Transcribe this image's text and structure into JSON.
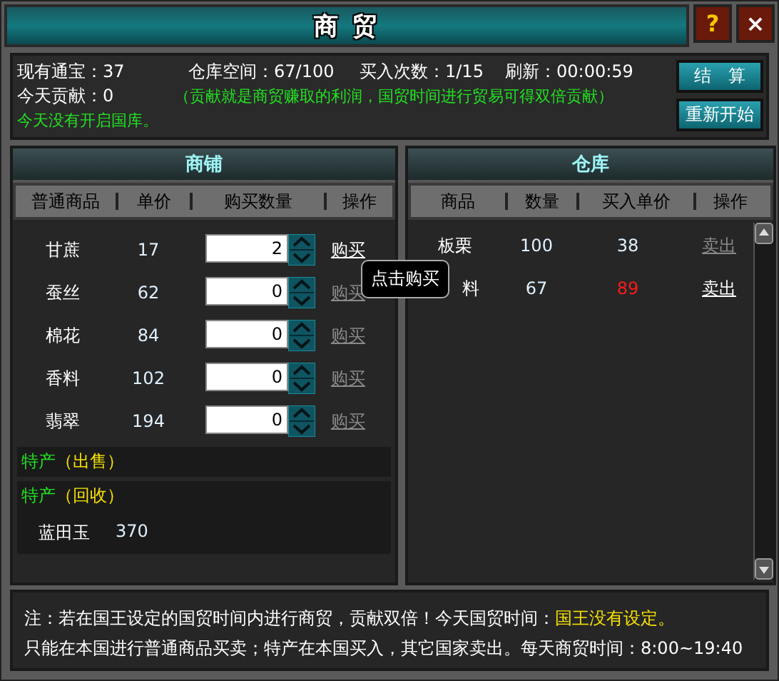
{
  "window": {
    "title": "商 贸",
    "help_button": "?",
    "close_button": "×"
  },
  "stats": [
    {
      "label": "现有通宝：",
      "value": "37"
    },
    {
      "label": "仓库空间：",
      "value": "67/100"
    },
    {
      "label": "买入次数：",
      "value": "1/15"
    },
    {
      "label": "刷新：",
      "value": "00:00:59"
    }
  ],
  "contribution": {
    "label": "今天贡献：",
    "value": "0",
    "hint": "（贡献就是商贸赚取的利润，国贸时间进行贸易可得双倍贡献）"
  },
  "treasury_notice": "今天没有开启国库。",
  "actions": [
    "结　算",
    "重新开始"
  ],
  "shop": {
    "title": "商铺",
    "columns": [
      "普通商品",
      "单价",
      "购买数量",
      "操作"
    ],
    "rows": [
      {
        "name": "甘蔗",
        "price": "17",
        "quantity": "2",
        "action": "购买",
        "disabled": false
      },
      {
        "name": "蚕丝",
        "price": "62",
        "quantity": "0",
        "action": "购买",
        "disabled": true
      },
      {
        "name": "棉花",
        "price": "84",
        "quantity": "0",
        "action": "购买",
        "disabled": true
      },
      {
        "name": "香料",
        "price": "102",
        "quantity": "0",
        "action": "购买",
        "disabled": true
      },
      {
        "name": "翡翠",
        "price": "194",
        "quantity": "0",
        "action": "购买",
        "disabled": true
      }
    ],
    "specials": [
      {
        "title": "特产",
        "subtitle": "（出售）"
      },
      {
        "title": "特产",
        "subtitle": "（回收）",
        "items": [
          {
            "name": "蓝田玉",
            "price": "370"
          }
        ]
      }
    ]
  },
  "tooltip": "点击购买",
  "warehouse": {
    "title": "仓库",
    "columns": [
      "商品",
      "数量",
      "买入单价",
      "操作"
    ],
    "rows": [
      {
        "name": "板栗",
        "quantity": "100",
        "buy_price": "38",
        "price_alert": false,
        "action": "卖出",
        "disabled": true
      },
      {
        "name": "料",
        "quantity": "67",
        "buy_price": "89",
        "price_alert": true,
        "action": "卖出",
        "disabled": false
      }
    ]
  },
  "notes": {
    "line1": "注：若在国王设定的国贸时间内进行商贸，贡献双倍！今天国贸时间：",
    "line1_highlight": "国王没有设定。",
    "line2": "只能在本国进行普通商品买卖；特产在本国买入，其它国家卖出。每天商贸时间：8:00~19:40"
  }
}
